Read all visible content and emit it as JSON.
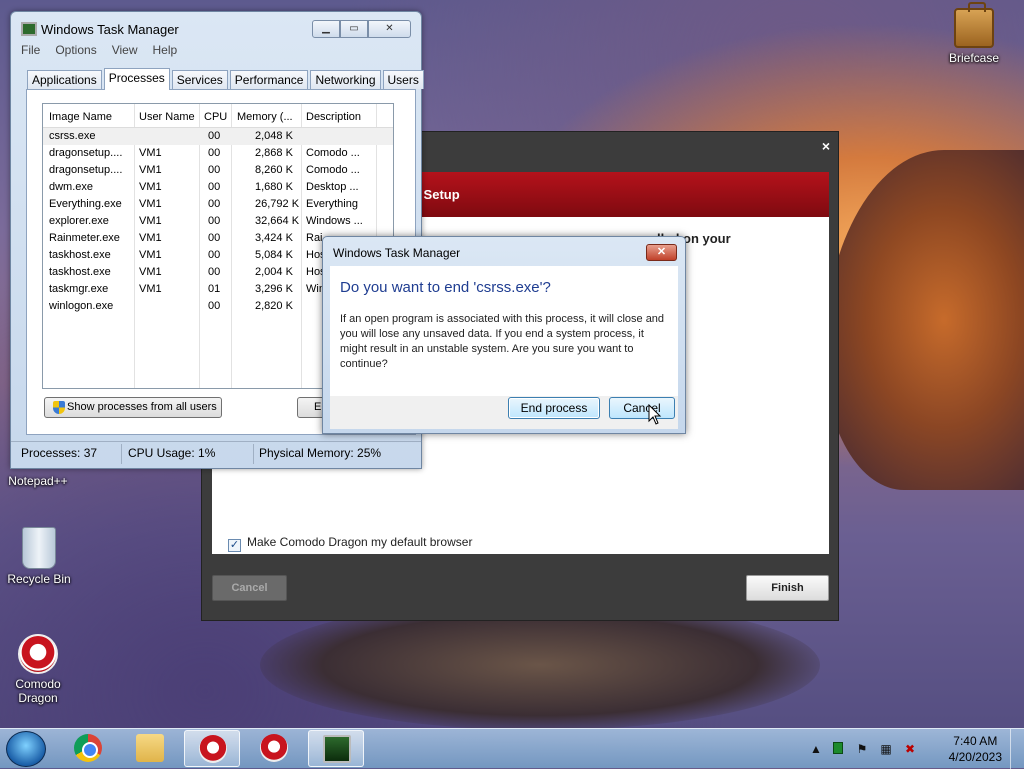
{
  "desktop": {
    "icons": [
      {
        "label": "Briefcase"
      },
      {
        "label": "Notepad++"
      },
      {
        "label": "Recycle Bin"
      },
      {
        "label": "Comodo Dragon"
      }
    ]
  },
  "setup_window": {
    "banner": "n Setup",
    "heading_left": "",
    "heading_right": "lled on your",
    "default_browser_label": "Make Comodo Dragon my default browser",
    "default_browser_checked": true,
    "cancel_label": "Cancel",
    "finish_label": "Finish",
    "close_glyph": "×"
  },
  "task_manager": {
    "title": "Windows Task Manager",
    "menu": [
      "File",
      "Options",
      "View",
      "Help"
    ],
    "tabs": [
      "Applications",
      "Processes",
      "Services",
      "Performance",
      "Networking",
      "Users"
    ],
    "active_tab": "Processes",
    "columns": [
      "Image Name",
      "User Name",
      "CPU",
      "Memory (...",
      "Description"
    ],
    "rows": [
      {
        "name": "csrss.exe",
        "user": "",
        "cpu": "00",
        "mem": "2,048 K",
        "desc": ""
      },
      {
        "name": "dragonsetup....",
        "user": "VM1",
        "cpu": "00",
        "mem": "2,868 K",
        "desc": "Comodo ..."
      },
      {
        "name": "dragonsetup....",
        "user": "VM1",
        "cpu": "00",
        "mem": "8,260 K",
        "desc": "Comodo ..."
      },
      {
        "name": "dwm.exe",
        "user": "VM1",
        "cpu": "00",
        "mem": "1,680 K",
        "desc": "Desktop ..."
      },
      {
        "name": "Everything.exe",
        "user": "VM1",
        "cpu": "00",
        "mem": "26,792 K",
        "desc": "Everything"
      },
      {
        "name": "explorer.exe",
        "user": "VM1",
        "cpu": "00",
        "mem": "32,664 K",
        "desc": "Windows ..."
      },
      {
        "name": "Rainmeter.exe",
        "user": "VM1",
        "cpu": "00",
        "mem": "3,424 K",
        "desc": "Rai"
      },
      {
        "name": "taskhost.exe",
        "user": "VM1",
        "cpu": "00",
        "mem": "5,084 K",
        "desc": "Hos"
      },
      {
        "name": "taskhost.exe",
        "user": "VM1",
        "cpu": "00",
        "mem": "2,004 K",
        "desc": "Hos"
      },
      {
        "name": "taskmgr.exe",
        "user": "VM1",
        "cpu": "01",
        "mem": "3,296 K",
        "desc": "Win"
      },
      {
        "name": "winlogon.exe",
        "user": "",
        "cpu": "00",
        "mem": "2,820 K",
        "desc": ""
      }
    ],
    "show_all_label": "Show processes from all users",
    "end_label": "E",
    "status": {
      "processes": "Processes: 37",
      "cpu": "CPU Usage: 1%",
      "memory": "Physical Memory: 25%"
    },
    "buttons": {
      "minimize": "▁",
      "maximize": "▭",
      "close": "✕"
    }
  },
  "confirm_dialog": {
    "title": "Windows Task Manager",
    "question": "Do you want to end 'csrss.exe'?",
    "message": "If an open program is associated with this process, it will close and you will lose any unsaved data. If you end a system process, it might result in an unstable system. Are you sure you want to continue?",
    "end_label": "End process",
    "cancel_label": "Cancel",
    "close_glyph": "✕"
  },
  "taskbar": {
    "clock_time": "7:40 AM",
    "clock_date": "4/20/2023",
    "tray_icons": [
      "show-hidden-icon",
      "green-app-icon",
      "flag-icon",
      "network-icon",
      "volume-muted-icon"
    ]
  }
}
